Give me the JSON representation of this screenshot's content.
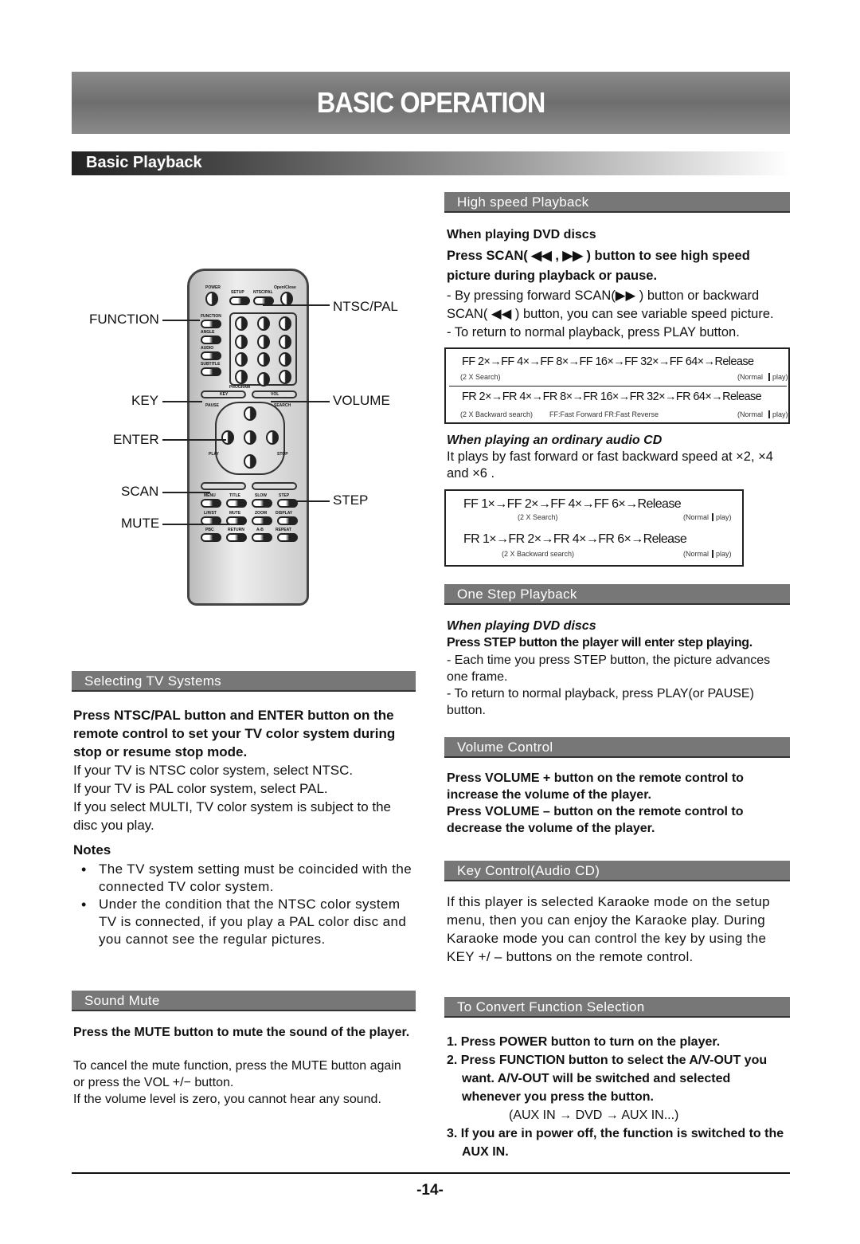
{
  "title": "BASIC OPERATION",
  "subtitle": "Basic Playback",
  "remote": {
    "callouts": {
      "function": "FUNCTION",
      "key": "KEY",
      "enter": "ENTER",
      "scan": "SCAN",
      "mute": "MUTE",
      "ntsc": "NTSC/PAL",
      "volume": "VOLUME",
      "step": "STEP"
    },
    "buttons": [
      "POWER",
      "SETUP",
      "NTSC/PAL",
      "Open/Close",
      "FUNCTION",
      "ANGLE",
      "AUDIO",
      "SUBTITLE",
      "PROGRAM",
      "KEY",
      "VOL",
      "PAUSE",
      "SEARCH",
      "PLAY",
      "STOP",
      "MENU",
      "TITLE",
      "SLOW",
      "STEP",
      "L/R/ST",
      "MUTE",
      "ZOOM",
      "DISPLAY",
      "PBC",
      "RETURN",
      "A-B",
      "REPEAT"
    ]
  },
  "tv": {
    "header": "Selecting TV Systems",
    "bold": "Press NTSC/PAL button and ENTER button on the remote control to set your TV color system during stop or resume stop mode.",
    "lines": [
      "If your TV is NTSC color system, select NTSC.",
      "If your TV is PAL color system, select PAL.",
      "If you select MULTI, TV color system is subject to the disc you play."
    ],
    "notes_title": "Notes",
    "notes": [
      "The TV system setting must be coincided with the connected TV color system.",
      "Under the condition that the NTSC color system TV is  connected, if you play  a PAL color disc and  you cannot see the regular pictures."
    ]
  },
  "mute": {
    "header": "Sound Mute",
    "bold": "Press the MUTE button to mute the sound  of the player.",
    "lines": [
      "To cancel the mute function, press the MUTE button again or press the VOL +/− button.",
      "If the volume level is zero, you cannot hear any sound."
    ]
  },
  "high": {
    "header": "High speed  Playback",
    "dvd_title": "When playing DVD discs",
    "dvd_bold": "Press SCAN( ◀◀ , ▶▶ ) button  to see high speed picture during playback or pause.",
    "dvd_lines": [
      "- By pressing forward  SCAN(▶▶ ) button or backward SCAN( ◀◀ ) button, you can see variable speed picture.",
      "- To return to normal  playback, press PLAY  button."
    ],
    "ff_row": "FF 2×→FF 4×→FF 8×→FF 16×→FF 32×→FF 64×→Release",
    "ff_note": "(2 X Search)",
    "ff_normal": "(Normal",
    "ff_play": "play)",
    "fr_row": "FR 2×→FR 4×→FR 8×→FR 16×→FR 32×→FR 64×→Release",
    "fr_note": "(2 X Backward search)",
    "fr_legend": "FF:Fast Forward   FR:Fast Reverse",
    "fr_normal": "(Normal",
    "fr_play": "play)",
    "cd_title": "When playing an ordinary audio CD",
    "cd_text": "It plays by fast forward or fast backward speed at  ×2, ×4 and ×6 .",
    "cd_ff": "FF 1×→FF 2×→FF 4×→FF 6×→Release",
    "cd_ff_note": "(2 X Search)",
    "cd_ff_normal": "(Normal",
    "cd_ff_play": "play)",
    "cd_fr": "FR 1×→FR 2×→FR 4×→FR 6×→Release",
    "cd_fr_note": "(2 X Backward search)",
    "cd_fr_normal": "(Normal",
    "cd_fr_play": "play)"
  },
  "step": {
    "header": "One Step  Playback",
    "title": "When playing DVD discs",
    "bold": "Press STEP button  the player will enter step playing.",
    "lines": [
      "- Each time you press STEP button, the picture advances one frame.",
      "- To return to normal playback, press PLAY(or PAUSE) button."
    ]
  },
  "volume": {
    "header": "Volume Control",
    "bold1": "Press VOLUME + button on the remote control to increase the volume of the player.",
    "bold2": "Press VOLUME – button on the remote control to decrease the volume of the player."
  },
  "keyctl": {
    "header": "Key Control(Audio CD)",
    "text": "If this player is selected Karaoke mode on the setup menu, then you can enjoy the Karaoke play. During Karaoke mode you can control the key by using the KEY +/ – buttons on the remote control."
  },
  "convert": {
    "header": "To Convert Function Selection",
    "items": [
      "1. Press POWER button to turn on the player.",
      "2. Press FUNCTION button to select the A/V-OUT you want. A/V-OUT will be switched and selected whenever you press the button.",
      "3. If you are in power off, the function is switched to the AUX IN."
    ],
    "seq": "(AUX IN  → DVD → AUX IN...)"
  },
  "page_number": "-14-"
}
